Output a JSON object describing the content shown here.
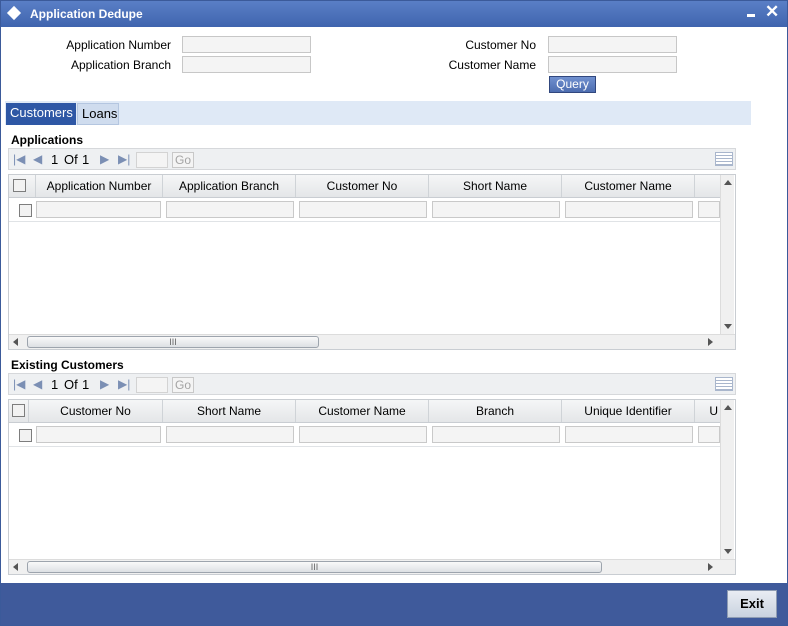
{
  "window": {
    "title": "Application Dedupe"
  },
  "form": {
    "application_number_label": "Application Number",
    "application_branch_label": "Application Branch",
    "customer_no_label": "Customer No",
    "customer_name_label": "Customer Name",
    "application_number_value": "",
    "application_branch_value": "",
    "customer_no_value": "",
    "customer_name_value": "",
    "query_button": "Query"
  },
  "tabs": [
    {
      "label": "Customers",
      "active": true
    },
    {
      "label": "Loans",
      "active": false
    }
  ],
  "applications": {
    "title": "Applications",
    "pager": {
      "current": "1",
      "of_label": "Of",
      "total": "1",
      "go_label": "Go"
    },
    "columns": [
      "Application Number",
      "Application Branch",
      "Customer No",
      "Short Name",
      "Customer Name"
    ],
    "scroll_grip": "III"
  },
  "existing_customers": {
    "title": "Existing Customers",
    "pager": {
      "current": "1",
      "of_label": "Of",
      "total": "1",
      "go_label": "Go"
    },
    "columns": [
      "Customer No",
      "Short Name",
      "Customer Name",
      "Branch",
      "Unique Identifier",
      "U"
    ],
    "scroll_grip": "III"
  },
  "footer": {
    "exit_button": "Exit"
  },
  "colors": {
    "titlebar": "#4a6fb8",
    "footer": "#3f5a9b",
    "active_tab": "#2e57a5"
  }
}
